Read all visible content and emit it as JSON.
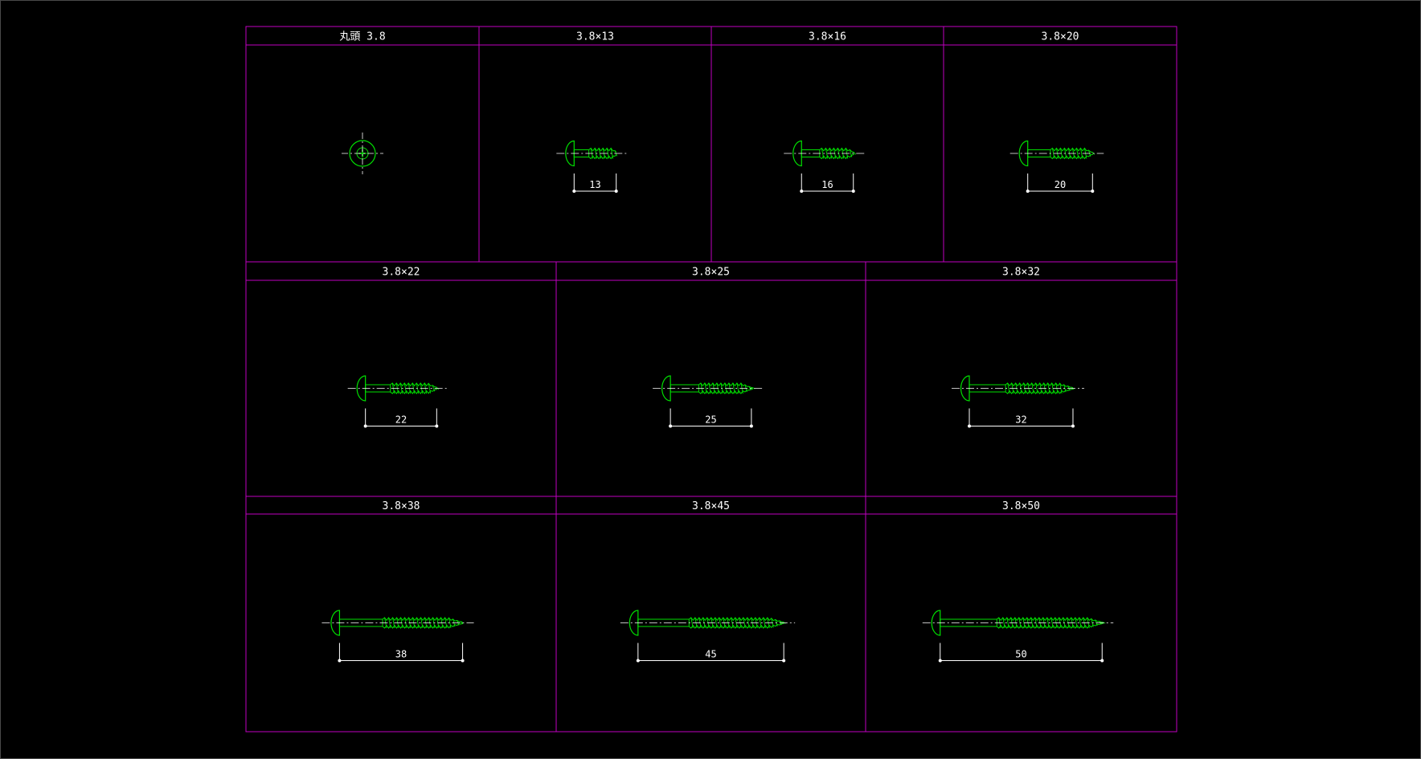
{
  "colors": {
    "background": "#000000",
    "frame": "#c000c0",
    "screw": "#00e000",
    "center_line": "#ffffff",
    "dimension": "#ffffff"
  },
  "cells": [
    {
      "title": "丸頭 3.8",
      "view": "top",
      "length": null,
      "dimension_label": ""
    },
    {
      "title": "3.8×13",
      "view": "side",
      "length": 13,
      "dimension_label": "13"
    },
    {
      "title": "3.8×16",
      "view": "side",
      "length": 16,
      "dimension_label": "16"
    },
    {
      "title": "3.8×20",
      "view": "side",
      "length": 20,
      "dimension_label": "20"
    },
    {
      "title": "3.8×22",
      "view": "side",
      "length": 22,
      "dimension_label": "22"
    },
    {
      "title": "3.8×25",
      "view": "side",
      "length": 25,
      "dimension_label": "25"
    },
    {
      "title": "3.8×32",
      "view": "side",
      "length": 32,
      "dimension_label": "32"
    },
    {
      "title": "3.8×38",
      "view": "side",
      "length": 38,
      "dimension_label": "38"
    },
    {
      "title": "3.8×45",
      "view": "side",
      "length": 45,
      "dimension_label": "45"
    },
    {
      "title": "3.8×50",
      "view": "side",
      "length": 50,
      "dimension_label": "50"
    }
  ]
}
